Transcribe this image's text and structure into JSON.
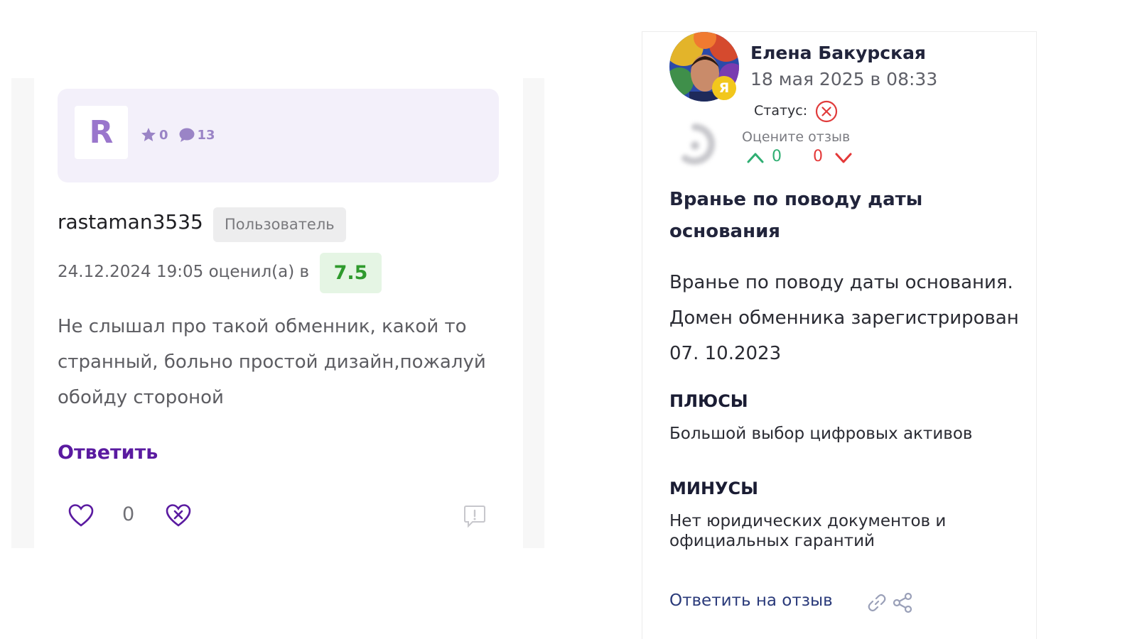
{
  "left_review": {
    "avatar_letter": "R",
    "stars_count": "0",
    "comments_count": "13",
    "username": "rastaman3535",
    "role": "Пользователь",
    "date_text": "24.12.2024 19:05 оценил(а) в",
    "score": "7.5",
    "comment": "Не слышал про такой обменник, какой то странный, больно простой дизайн,пожалуй обойду стороной",
    "reply_label": "Ответить",
    "likes_count": "0"
  },
  "right_review": {
    "author_name": "Елена Бакурская",
    "date": "18 мая 2025 в 08:33",
    "badge_letter": "Я",
    "status_label": "Статус:",
    "rate_prompt": "Оцените отзыв",
    "upvotes": "0",
    "downvotes": "0",
    "title": "Вранье по поводу даты основания",
    "body": "Вранье по поводу даты основания. Домен обменника зарегистрирован 07. 10.2023",
    "pros_heading": "ПЛЮСЫ",
    "pros_text": "Большой выбор цифровых активов",
    "cons_heading": "МИНУСЫ",
    "cons_text": "Нет юридических документов и официальных гарантий",
    "reply_label": "Ответить на отзыв"
  },
  "colors": {
    "purple_accent": "#5a1aa0",
    "lavender_bg": "#f3f0fa",
    "score_green": "#2f9a2d",
    "score_bg": "#e5f5e4",
    "upvote_green": "#2fae72",
    "downvote_red": "#e43838",
    "heading_navy": "#21243b"
  },
  "icons": [
    "star-icon",
    "comment-icon",
    "heart-icon",
    "heart-x-icon",
    "report-icon",
    "status-rejected-icon",
    "loading-spinner-icon",
    "arrow-up-icon",
    "arrow-down-icon",
    "link-icon",
    "share-icon"
  ]
}
